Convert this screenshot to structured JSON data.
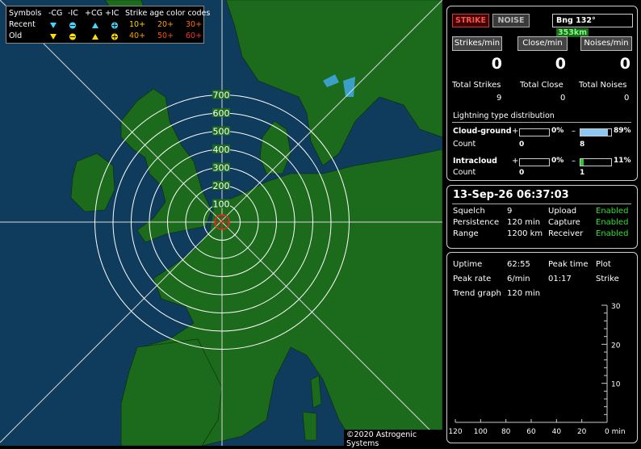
{
  "legend": {
    "symbols_label": "Symbols",
    "col_cg_neg": "-CG",
    "col_ic_neg": "-IC",
    "col_cg_pos": "+CG",
    "col_ic_pos": "+IC",
    "recent_label": "Recent",
    "old_label": "Old",
    "age_title": "Strike age color codes",
    "recent_ages": [
      "10+",
      "20+",
      "30+"
    ],
    "old_ages": [
      "40+",
      "50+",
      "60+"
    ],
    "recent_age_colors": [
      "#ffd800",
      "#ffa000",
      "#ff7000"
    ],
    "old_age_colors": [
      "#ffa000",
      "#ff5000",
      "#ff3030"
    ],
    "recent_symbol_color": "#40d8ff",
    "old_symbol_color": "#ffe000"
  },
  "map": {
    "range_labels": [
      "100",
      "200",
      "300",
      "400",
      "500",
      "600",
      "700"
    ],
    "copyright": "©2020 Astrogenic Systems",
    "sea_color": "#0f3c5c",
    "land_color": "#1c6a1c"
  },
  "status": {
    "strike_label": "STRIKE",
    "noise_label": "NOISE",
    "bearing": "Bng 132°",
    "distance": "353km",
    "strikes_per_min_label": "Strikes/min",
    "close_per_min_label": "Close/min",
    "noises_per_min_label": "Noises/min",
    "strikes_per_min": "0",
    "close_per_min": "0",
    "noises_per_min": "0",
    "total_strikes_label": "Total Strikes",
    "total_close_label": "Total Close",
    "total_noises_label": "Total Noises",
    "total_strikes": "9",
    "total_close": "0",
    "total_noises": "0",
    "distribution_title": "Lightning type distribution",
    "cg_label": "Cloud-ground",
    "ic_label": "Intracloud",
    "count_label": "Count",
    "plus": "+",
    "minus": "–",
    "cg_pos_pct": "0%",
    "cg_neg_pct": "89%",
    "cg_pos_count": "0",
    "cg_neg_count": "8",
    "ic_pos_pct": "0%",
    "ic_neg_pct": "11%",
    "ic_pos_count": "0",
    "ic_neg_count": "1",
    "cg_neg_fraction": 0.89,
    "ic_neg_fraction": 0.11,
    "cg_bar_color": "#8ec8f0",
    "ic_bar_color": "#20d020"
  },
  "info": {
    "datetime": "13-Sep-26 06:37:03",
    "squelch_label": "Squelch",
    "squelch": "9",
    "persistence_label": "Persistence",
    "persistence": "120 min",
    "range_label": "Range",
    "range": "1200 km",
    "upload_label": "Upload",
    "upload": "Enabled",
    "capture_label": "Capture",
    "capture": "Enabled",
    "receiver_label": "Receiver",
    "receiver": "Enabled"
  },
  "stats": {
    "uptime_label": "Uptime",
    "uptime": "62:55",
    "peak_time_label": "Peak time",
    "plot_label": "Plot",
    "peak_rate_label": "Peak rate",
    "peak_rate": "6/min",
    "peak_time": "01:17",
    "plot": "Strike",
    "trend_label": "Trend graph",
    "trend_span": "120 min",
    "y_ticks": [
      "30",
      "20",
      "10"
    ],
    "x_ticks": [
      "120",
      "100",
      "80",
      "60",
      "40",
      "20",
      "0 min"
    ]
  }
}
